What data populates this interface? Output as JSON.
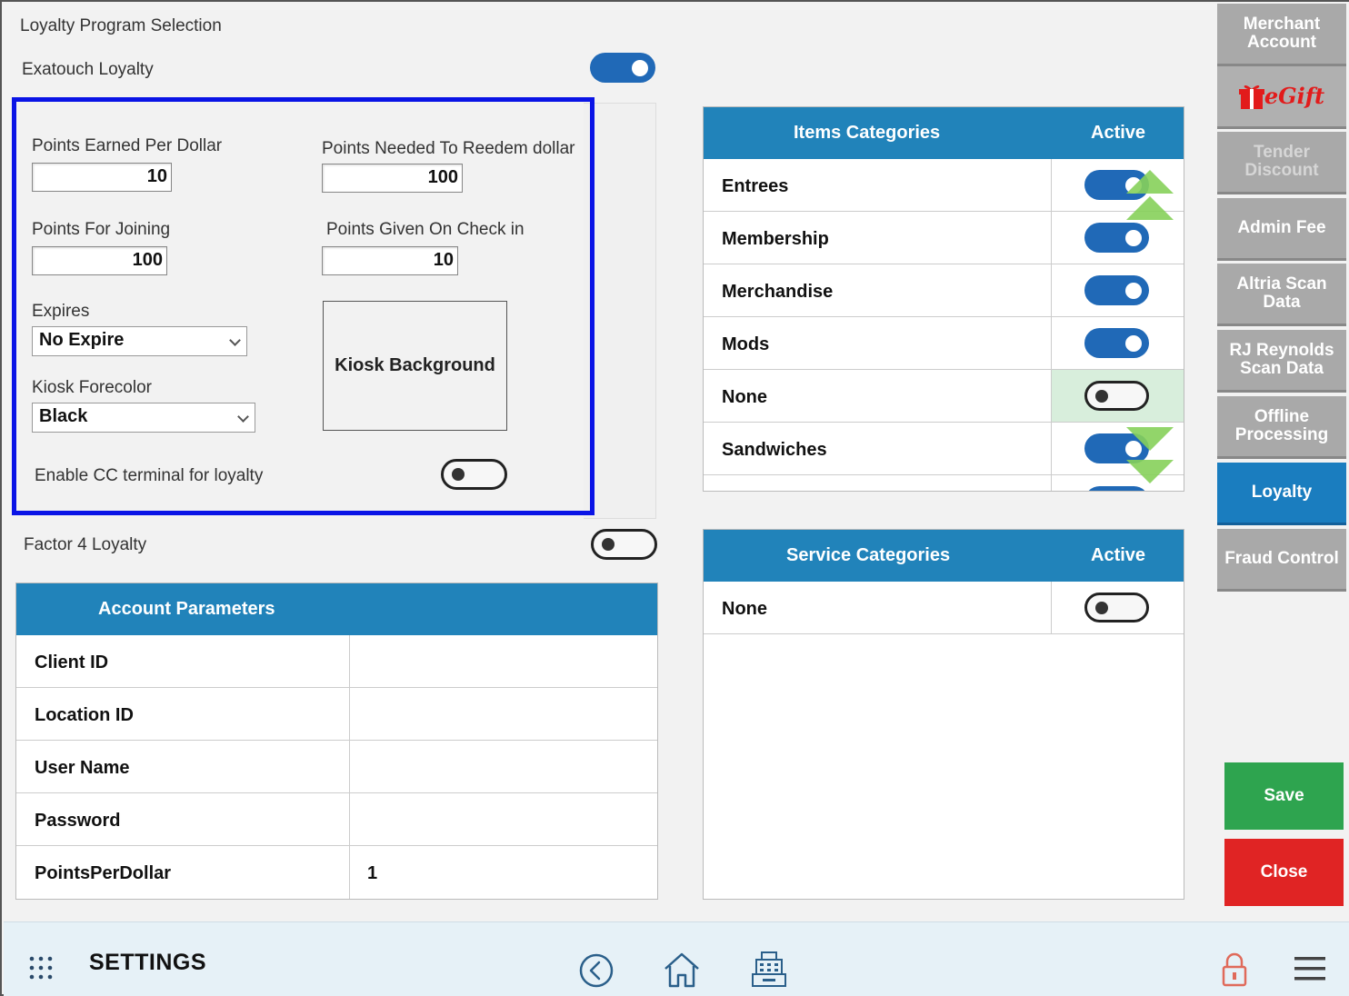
{
  "loyalty_section": {
    "title": "Loyalty Program Selection",
    "exatouch_label": "Exatouch Loyalty",
    "exatouch_enabled": true,
    "points_earned_label": "Points Earned Per Dollar",
    "points_earned_value": "10",
    "points_needed_label": "Points Needed To Reedem dollar",
    "points_needed_value": "100",
    "points_joining_label": "Points For Joining",
    "points_joining_value": "100",
    "points_checkin_label": "Points Given On Check in",
    "points_checkin_value": "10",
    "expires_label": "Expires",
    "expires_value": "No Expire",
    "forecolor_label": "Kiosk Forecolor",
    "forecolor_value": "Black",
    "kiosk_background_label": "Kiosk Background",
    "cc_terminal_label": "Enable CC terminal for loyalty",
    "cc_terminal_enabled": false,
    "factor4_label": "Factor 4 Loyalty",
    "factor4_enabled": false
  },
  "account_parameters": {
    "header": "Account Parameters",
    "rows": [
      {
        "name": "Client ID",
        "value": ""
      },
      {
        "name": "Location ID",
        "value": ""
      },
      {
        "name": "User Name",
        "value": ""
      },
      {
        "name": "Password",
        "value": ""
      },
      {
        "name": "PointsPerDollar",
        "value": "1"
      }
    ]
  },
  "items_categories": {
    "header": "Items Categories",
    "active_header": "Active",
    "rows": [
      {
        "name": "Entrees",
        "active": true
      },
      {
        "name": "Membership",
        "active": true
      },
      {
        "name": "Merchandise",
        "active": true
      },
      {
        "name": "Mods",
        "active": true
      },
      {
        "name": "None",
        "active": false
      },
      {
        "name": "Sandwiches",
        "active": true
      }
    ]
  },
  "service_categories": {
    "header": "Service Categories",
    "active_header": "Active",
    "rows": [
      {
        "name": "None",
        "active": false
      }
    ]
  },
  "sidebar": {
    "merchant_account": "Merchant Account",
    "egift_logo": "eGift",
    "tender_discount": "Tender Discount",
    "admin_fee": "Admin Fee",
    "altria": "Altria Scan Data",
    "rj_reynolds": "RJ Reynolds Scan Data",
    "offline": "Offline Processing",
    "loyalty": "Loyalty",
    "fraud": "Fraud Control",
    "save": "Save",
    "close": "Close"
  },
  "bottom_bar": {
    "title": "SETTINGS"
  },
  "colors": {
    "accent_blue": "#2183ba",
    "toggle_on": "#2069b7",
    "highlight_box": "#0a14e6",
    "save_green": "#2ea44f",
    "close_red": "#e02424",
    "selected_row": "#d8eedc"
  }
}
